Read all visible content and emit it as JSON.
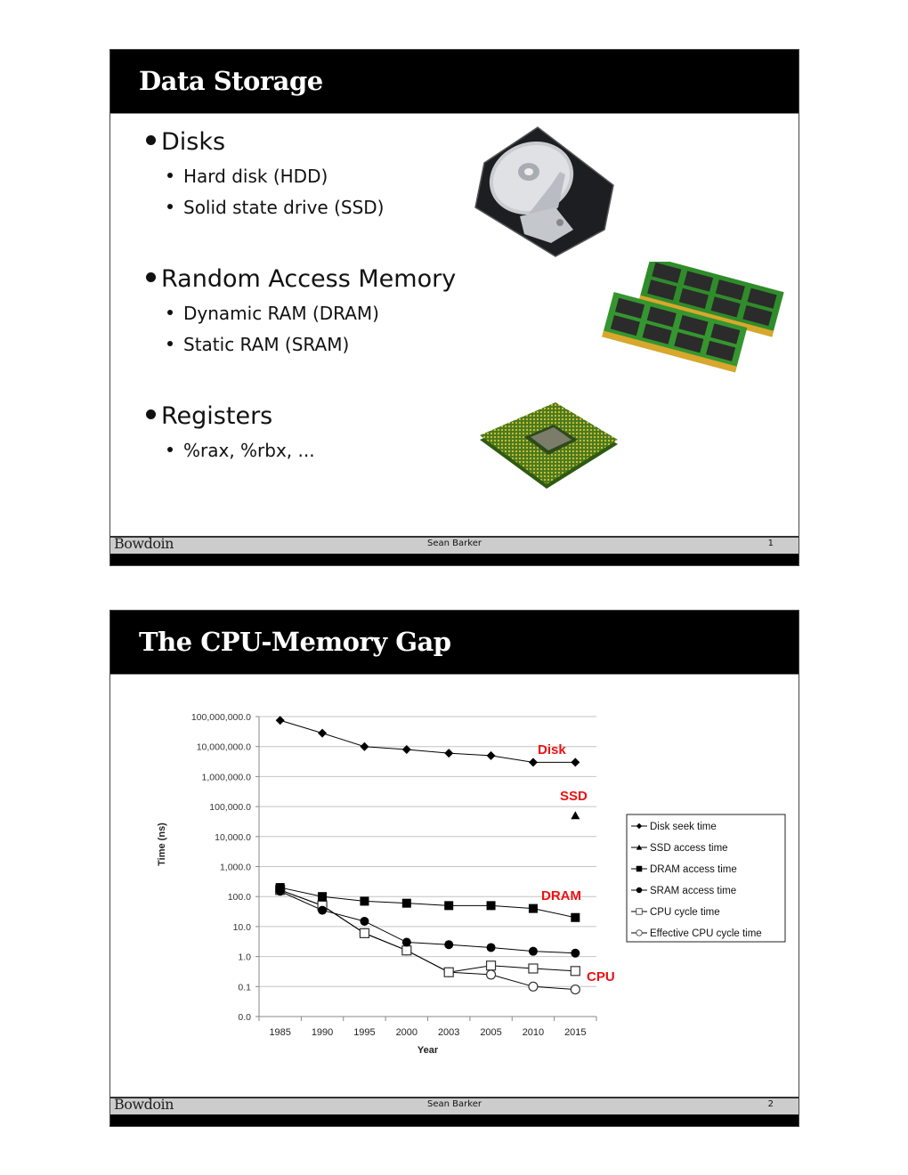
{
  "slides": [
    {
      "title": "Data Storage",
      "bullets": [
        {
          "text": "Disks",
          "sub": [
            "Hard disk (HDD)",
            "Solid state drive (SSD)"
          ],
          "image": "hard-disk-drive-photo"
        },
        {
          "text": "Random Access Memory",
          "sub": [
            "Dynamic RAM (DRAM)",
            "Static RAM (SRAM)"
          ],
          "image": "ram-modules-photo"
        },
        {
          "text": "Registers",
          "sub": [
            "%rax, %rbx, ..."
          ],
          "image": "cpu-chip-photo"
        }
      ],
      "footer": {
        "logo": "Bowdoin",
        "author": "Sean Barker",
        "page": "1"
      }
    },
    {
      "title": "The CPU-Memory Gap",
      "footer": {
        "logo": "Bowdoin",
        "author": "Sean Barker",
        "page": "2"
      },
      "annotations": [
        "Disk",
        "SSD",
        "DRAM",
        "CPU"
      ]
    }
  ],
  "colors": {
    "annotation": "#ee1111",
    "title_bar": "#000000",
    "footer_band": "#cccccc"
  },
  "chart_data": {
    "type": "line",
    "title": "",
    "xlabel": "Year",
    "ylabel": "Time (ns)",
    "yscale": "log",
    "ylim": [
      0.01,
      100000000
    ],
    "ytick_labels": [
      "0.0",
      "0.1",
      "1.0",
      "10.0",
      "100.0",
      "1,000.0",
      "10,000.0",
      "100,000.0",
      "1,000,000.0",
      "10,000,000.0",
      "100,000,000.0"
    ],
    "ytick_values": [
      0.01,
      0.1,
      1,
      10,
      100,
      1000,
      10000,
      100000,
      1000000,
      10000000,
      100000000
    ],
    "categories": [
      "1985",
      "1990",
      "1995",
      "2000",
      "2003",
      "2005",
      "2010",
      "2015"
    ],
    "grid": true,
    "legend_position": "right",
    "series": [
      {
        "name": "Disk seek time",
        "marker": "diamond-filled",
        "values": [
          75000000,
          28000000,
          10000000,
          8000000,
          6000000,
          5000000,
          3000000,
          3000000
        ]
      },
      {
        "name": "SSD access time",
        "marker": "triangle-filled",
        "values": [
          null,
          null,
          null,
          null,
          null,
          null,
          null,
          50000
        ]
      },
      {
        "name": "DRAM access time",
        "marker": "square-filled",
        "values": [
          200,
          100,
          70,
          60,
          50,
          50,
          40,
          20
        ]
      },
      {
        "name": "SRAM access time",
        "marker": "circle-filled",
        "values": [
          150,
          35,
          15,
          3,
          2.5,
          2,
          1.5,
          1.3
        ]
      },
      {
        "name": "CPU cycle time",
        "marker": "square-open",
        "values": [
          166,
          50,
          6,
          1.6,
          0.3,
          0.5,
          0.4,
          0.33
        ]
      },
      {
        "name": "Effective CPU cycle time",
        "marker": "circle-open",
        "values": [
          166,
          50,
          6,
          1.6,
          0.3,
          0.25,
          0.1,
          0.08
        ]
      }
    ],
    "annotations": [
      {
        "text": "Disk",
        "x": "2015",
        "y": 10000000
      },
      {
        "text": "SSD",
        "x": "2015",
        "y": 200000
      },
      {
        "text": "DRAM",
        "x": "2015",
        "y": 100
      },
      {
        "text": "CPU",
        "x": "2015",
        "y": 0.2
      }
    ]
  }
}
